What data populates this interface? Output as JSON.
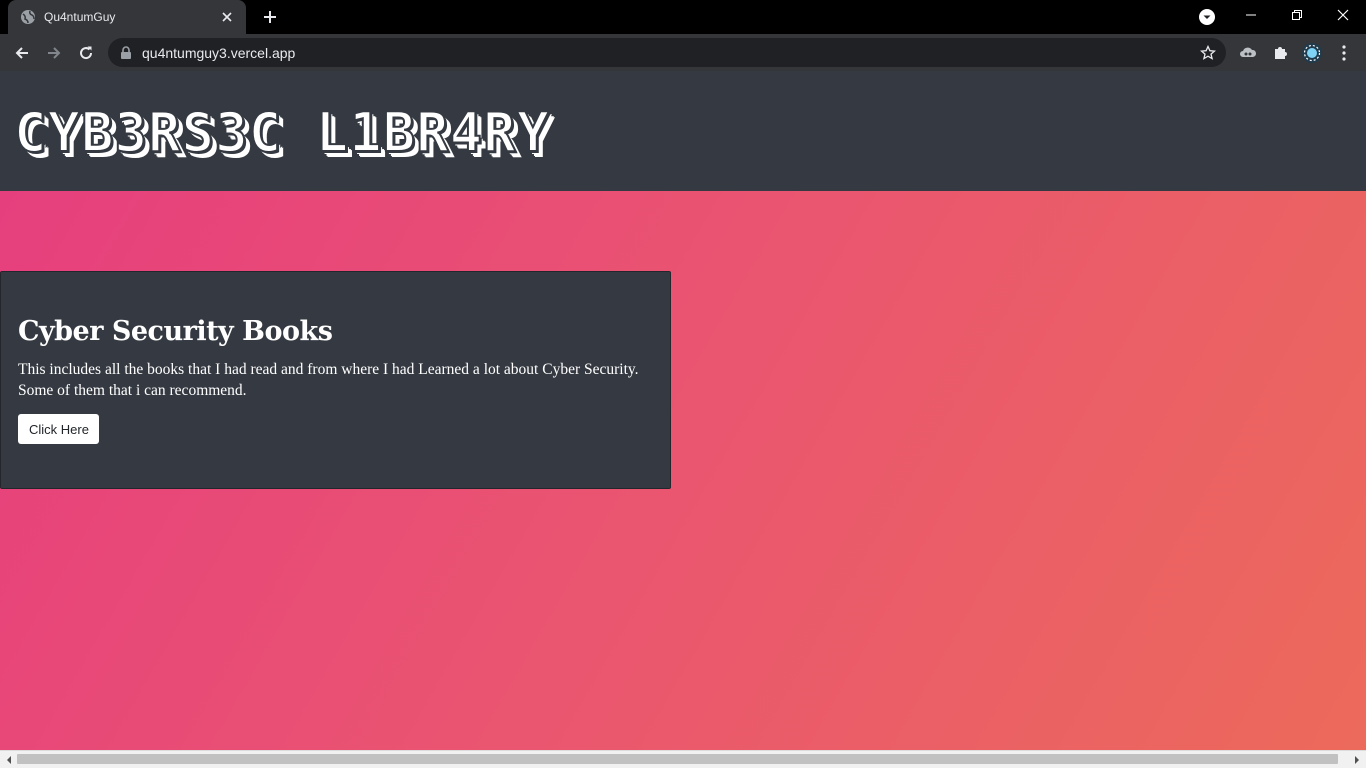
{
  "browser": {
    "tab": {
      "title": "Qu4ntumGuy",
      "favicon": "globe-icon"
    },
    "url": "qu4ntumguy3.vercel.app",
    "icons": {
      "back": "arrow-left-icon",
      "forward": "arrow-right-icon",
      "reload": "reload-icon",
      "bookmark": "star-icon",
      "extensions": "puzzle-icon",
      "menu": "kebab-icon"
    }
  },
  "header": {
    "title": "CYB3RS3C L1BR4RY",
    "bg_color": "#353a42"
  },
  "card": {
    "title": "Cyber Security Books",
    "text": "This includes all the books that I had read and from where I had Learned a lot about Cyber Security. Some of them that i can recommend.",
    "button_label": "Click Here",
    "bg_color": "#353a42"
  },
  "page": {
    "gradient_start": "#e63d7f",
    "gradient_end": "#ec6a5b"
  }
}
